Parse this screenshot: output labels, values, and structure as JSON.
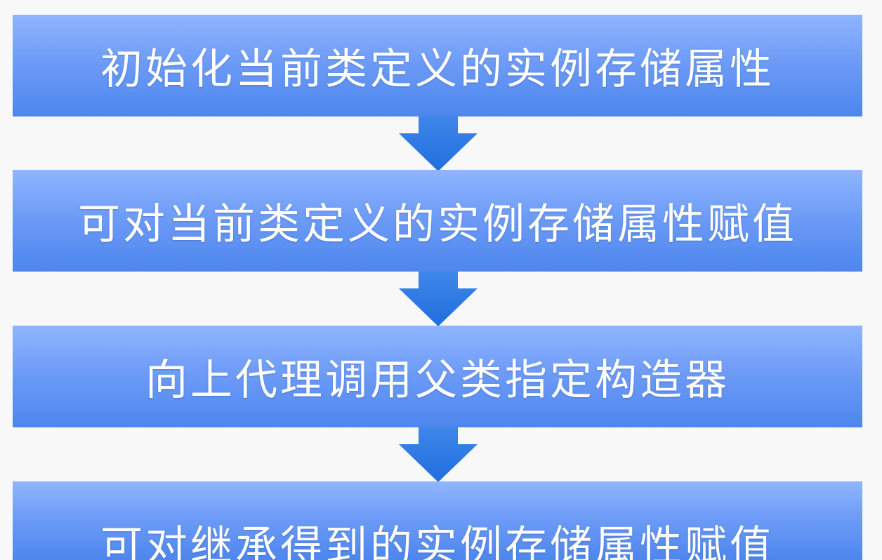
{
  "flow": {
    "steps": [
      {
        "label": "初始化当前类定义的实例存储属性"
      },
      {
        "label": "可对当前类定义的实例存储属性赋值"
      },
      {
        "label": "向上代理调用父类指定构造器"
      },
      {
        "label": "可对继承得到的实例存储属性赋值"
      }
    ],
    "arrow_icon": "down-arrow-icon",
    "colors": {
      "box_top": "#8fb5ff",
      "box_bottom": "#4d86ee",
      "arrow_top": "#3f86e8",
      "arrow_bottom": "#1f6fe0",
      "text": "#ffffff",
      "background": "#f8f8f8"
    }
  }
}
